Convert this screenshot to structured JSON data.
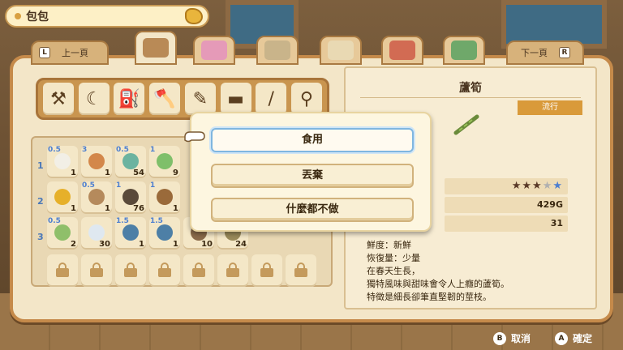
{
  "header": {
    "title": "包包"
  },
  "nav": {
    "prev_key": "L",
    "prev_label": "上一頁",
    "next_label": "下一頁",
    "next_key": "R"
  },
  "category_tabs": [
    {
      "name": "bag-tab",
      "color": "#b98a56"
    },
    {
      "name": "flowers-tab",
      "color": "#e59ab8"
    },
    {
      "name": "letter-info-tab",
      "color": "#c9b48a"
    },
    {
      "name": "mail-tab",
      "color": "#e9d9b3"
    },
    {
      "name": "shop-tab",
      "color": "#d26b53"
    },
    {
      "name": "notebook-tab",
      "color": "#6fa86a"
    }
  ],
  "tools": [
    {
      "icon": "hammer-icon",
      "glyph": "⚒"
    },
    {
      "icon": "sickle-icon",
      "glyph": "☾"
    },
    {
      "icon": "watering-can-icon",
      "glyph": "⛽"
    },
    {
      "icon": "axe-icon",
      "glyph": "🪓"
    },
    {
      "icon": "brush-icon",
      "glyph": "✎"
    },
    {
      "icon": "milker-icon",
      "glyph": "▬"
    },
    {
      "icon": "fishing-rod-icon",
      "glyph": "/"
    },
    {
      "icon": "hoe-icon",
      "glyph": "⚲"
    }
  ],
  "rows": [
    "1",
    "2",
    "3"
  ],
  "inventory": [
    {
      "item": "rice-ball",
      "star": "0.5",
      "qty": "1",
      "color": "#f2efe6"
    },
    {
      "item": "pretzel",
      "star": "3",
      "qty": "1",
      "color": "#d3874a"
    },
    {
      "item": "seed-bag-blue",
      "star": "0.5",
      "qty": "54",
      "color": "#6bb3a0"
    },
    {
      "item": "seed-bag-green",
      "star": "1",
      "qty": "9",
      "color": "#7fbf6a"
    },
    {
      "item": "honey-jar",
      "star": "",
      "qty": "1",
      "color": "#e6b02a"
    },
    {
      "item": "mushroom",
      "star": "0.5",
      "qty": "1",
      "color": "#b58a5c"
    },
    {
      "item": "ore-rock",
      "star": "1",
      "qty": "76",
      "color": "#5a4a3a"
    },
    {
      "item": "lumber",
      "star": "1",
      "qty": "1",
      "color": "#9a6a3a"
    },
    {
      "item": "seed-packet",
      "star": "0.5",
      "qty": "2",
      "color": "#8fbf6a"
    },
    {
      "item": "milk-can",
      "star": "",
      "qty": "30",
      "color": "#dfe8f0"
    },
    {
      "item": "jar-a",
      "star": "1.5",
      "qty": "1",
      "color": "#4d7fa6"
    },
    {
      "item": "jar-b",
      "star": "1.5",
      "qty": "1",
      "color": "#4d7fa6"
    },
    {
      "item": "item-11",
      "star": "",
      "qty": "10",
      "color": "#8a6a4a"
    },
    {
      "item": "item-12",
      "star": "",
      "qty": "24",
      "color": "#9a8a5a"
    }
  ],
  "detail": {
    "name": "蘆筍",
    "trend": "流行",
    "stars_full": "★★★",
    "stars_half": "★",
    "stars_empty": "★",
    "price": "429G",
    "count": "31",
    "freshness": "鮮度：新鮮",
    "recovery": "恢復量：少量",
    "desc_line1": "在春天生長，",
    "desc_line2": "獨特風味與甜味會令人上癮的蘆筍。",
    "desc_line3": "特徵是細長卻筆直堅韌的莖枝。"
  },
  "popup": {
    "eat": "食用",
    "discard": "丟棄",
    "nothing": "什麼都不做"
  },
  "footer": {
    "cancel_key": "B",
    "cancel_label": "取消",
    "confirm_key": "A",
    "confirm_label": "確定"
  }
}
